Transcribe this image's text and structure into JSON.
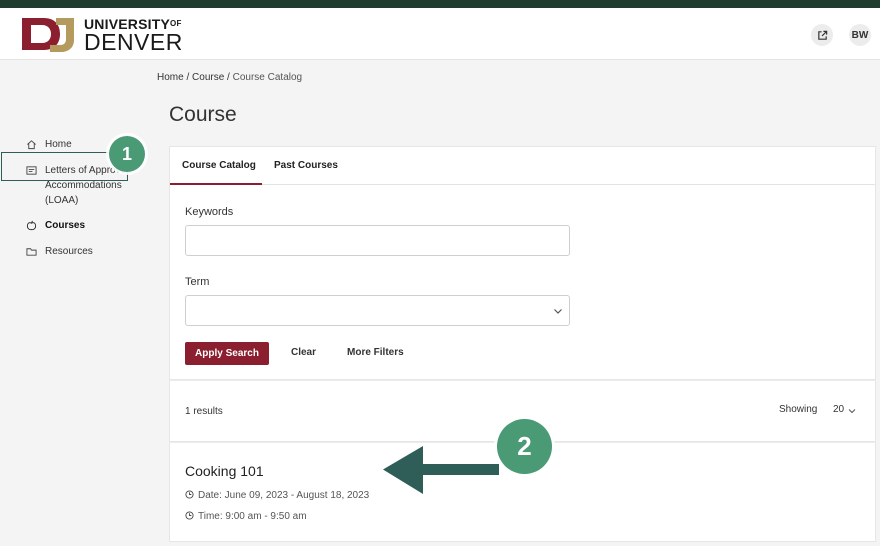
{
  "header": {
    "logo_top": "UNIVERSITY",
    "logo_of": "OF",
    "logo_bottom": "DENVER",
    "avatar": "BW",
    "external_icon": "external-link-icon",
    "brand_color": "#8b1e2f",
    "top_bar_color": "#1e3d2e"
  },
  "sidebar": {
    "items": [
      {
        "label": "Home",
        "icon": "home-icon"
      },
      {
        "label": "Letters of Approved Accommodations (LOAA)",
        "icon": "letter-icon"
      },
      {
        "label": "Courses",
        "icon": "apple-icon",
        "active": true
      },
      {
        "label": "Resources",
        "icon": "folder-icon"
      }
    ]
  },
  "callouts": {
    "one": "1",
    "two": "2",
    "color": "#4a9a76"
  },
  "breadcrumb": {
    "home": "Home",
    "sep1": " / ",
    "course": "Course",
    "sep2": " / ",
    "current": "Course Catalog"
  },
  "page_title": "Course",
  "tabs": [
    {
      "label": "Course Catalog",
      "active": true
    },
    {
      "label": "Past Courses",
      "active": false
    }
  ],
  "search": {
    "keywords_label": "Keywords",
    "keywords_value": "",
    "term_label": "Term",
    "term_value": "",
    "apply_label": "Apply Search",
    "clear_label": "Clear",
    "more_filters_label": "More Filters"
  },
  "results": {
    "count_text": "1 results",
    "showing_label": "Showing",
    "page_size": "20"
  },
  "course": {
    "title": "Cooking 101",
    "date": "Date: June 09, 2023 - August 18, 2023",
    "time": "Time: 9:00 am - 9:50 am"
  }
}
